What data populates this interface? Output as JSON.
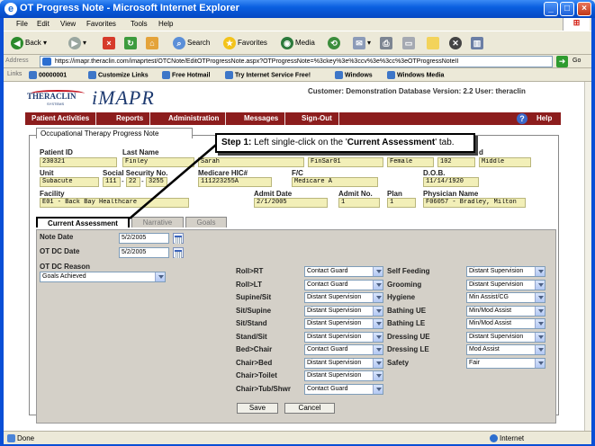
{
  "window": {
    "title": "OT Progress Note - Microsoft Internet Explorer"
  },
  "menu": [
    "File",
    "Edit",
    "View",
    "Favorites",
    "Tools",
    "Help"
  ],
  "toolbar": {
    "back": "Back",
    "search": "Search",
    "favorites": "Favorites",
    "media": "Media"
  },
  "address": {
    "label": "Address",
    "url": "https://imapr.theraclin.com/imaprtest/OTCNote/EditOTProgressNote.aspx?OTProgressNote=%3ckey%3e%3ccv%3e%3cc%3eOTProgressNoteII",
    "go": "Go"
  },
  "links": [
    "Links",
    "00000001",
    "Customize Links",
    "Free Hotmail",
    "Try Internet Service Free!",
    "Windows",
    "Windows Media"
  ],
  "status": {
    "left": "Done",
    "right": "Internet"
  },
  "app": {
    "logo_left": "THERACLIN",
    "logo_sub": "SYSTEMS",
    "logo_main": "iMAPR",
    "customer_line": "Customer: Demonstration Database Version: 2.2 User: theraclin",
    "nav": [
      "Patient Activities",
      "Reports",
      "Administration",
      "Messages",
      "Sign-Out"
    ],
    "help": "Help"
  },
  "callout": {
    "step": "Step 1:",
    "pre": " Left single-click on the '",
    "target": "Current Assessment",
    "post": "' tab."
  },
  "form": {
    "page_tab": "Occupational Therapy Progress Note",
    "patient_id_label": "Patient ID",
    "patient_id": "230321",
    "last_name_label": "Last Name",
    "last_name": "Finley",
    "first_name": "Sarah",
    "mid": "FinSar01",
    "sex": "Female",
    "room": "102",
    "middle_label": "d",
    "middle": "Middle",
    "unit_label": "Unit",
    "unit": "Subacute",
    "ssn_label": "Social Security No.",
    "ssn1": "111",
    "ssn2": "22",
    "ssn3": "3255",
    "medicare_label": "Medicare HIC#",
    "medicare": "111223255A",
    "fc_label": "F/C",
    "fc": "Medicare A",
    "dob_label": "D.O.B.",
    "dob": "11/14/1920",
    "facility_label": "Facility",
    "facility": "E01 - Back Bay Healthcare",
    "admit_date_label": "Admit Date",
    "admit_date": "2/1/2005",
    "admit_no_label": "Admit No.",
    "admit_no": "1",
    "plan_label": "Plan",
    "plan": "1",
    "physician_label": "Physician Name",
    "physician": "F06057 - Bradley, Milton"
  },
  "tabs": [
    "Current Assessment",
    "Narrative",
    "Goals"
  ],
  "assessment": {
    "note_date_label": "Note Date",
    "note_date": "5/2/2005",
    "ot_dc_date_label": "OT DC Date",
    "ot_dc_date": "5/2/2005",
    "ot_dc_reason_label": "OT DC Reason",
    "ot_dc_reason": "Goals Achieved",
    "mobility": [
      {
        "label": "Roll>RT",
        "value": "Contact Guard"
      },
      {
        "label": "Roll>LT",
        "value": "Contact Guard"
      },
      {
        "label": "Supine/Sit",
        "value": "Distant Supervision"
      },
      {
        "label": "Sit/Supine",
        "value": "Distant Supervision"
      },
      {
        "label": "Sit/Stand",
        "value": "Distant Supervision"
      },
      {
        "label": "Stand/Sit",
        "value": "Distant Supervision"
      },
      {
        "label": "Bed>Chair",
        "value": "Contact Guard"
      },
      {
        "label": "Chair>Bed",
        "value": "Distant Supervision"
      },
      {
        "label": "Chair>Toilet",
        "value": "Distant Supervision"
      },
      {
        "label": "Chair>Tub/Shwr",
        "value": "Contact Guard"
      }
    ],
    "selfcare": [
      {
        "label": "Self Feeding",
        "value": "Distant Supervision"
      },
      {
        "label": "Grooming",
        "value": "Distant Supervision"
      },
      {
        "label": "Hygiene",
        "value": "Min Assist/CG"
      },
      {
        "label": "Bathing UE",
        "value": "Min/Mod Assist"
      },
      {
        "label": "Bathing LE",
        "value": "Min/Mod Assist"
      },
      {
        "label": "Dressing UE",
        "value": "Distant Supervision"
      },
      {
        "label": "Dressing LE",
        "value": "Mod Assist"
      },
      {
        "label": "Safety",
        "value": "Fair"
      }
    ],
    "save": "Save",
    "cancel": "Cancel"
  }
}
